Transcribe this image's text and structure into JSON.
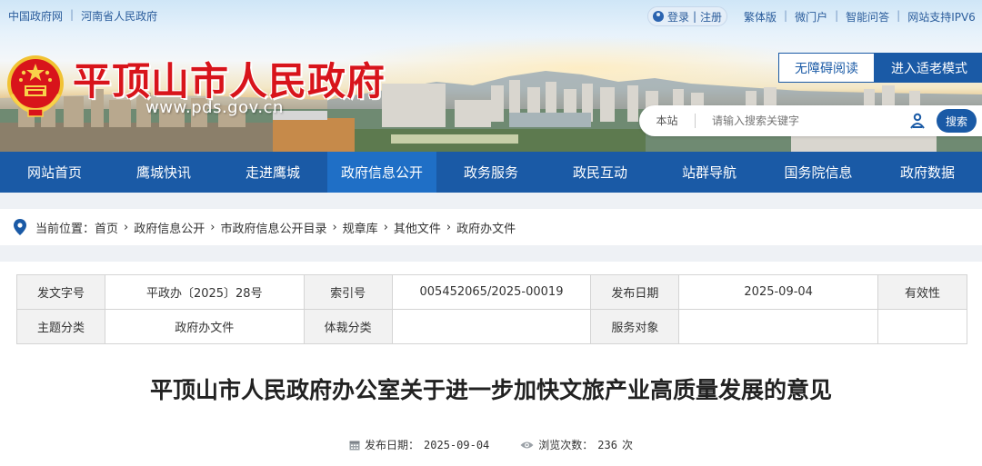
{
  "topbar": {
    "links": [
      "中国政府网",
      "河南省人民政府"
    ],
    "login": "登录",
    "register": "注册",
    "quick_links": [
      "繁体版",
      "微门户",
      "智能问答",
      "网站支持IPV6"
    ]
  },
  "header": {
    "site_title": "平顶山市人民政府",
    "site_url": "www.pds.gov.cn",
    "btn_barrier_free": "无障碍阅读",
    "btn_elder_mode": "进入适老模式",
    "search_scope": "本站",
    "search_placeholder": "请输入搜索关键字",
    "search_button": "搜索"
  },
  "nav": {
    "items": [
      "网站首页",
      "鹰城快讯",
      "走进鹰城",
      "政府信息公开",
      "政务服务",
      "政民互动",
      "站群导航",
      "国务院信息",
      "政府数据"
    ],
    "active": "政府信息公开"
  },
  "breadcrumb": {
    "label": "当前位置：",
    "items": [
      "首页",
      "政府信息公开",
      "市政府信息公开目录",
      "规章库",
      "其他文件",
      "政府办文件"
    ]
  },
  "meta_table": {
    "row1": [
      "发文字号",
      "平政办〔2025〕28号",
      "索引号",
      "005452065/2025-00019",
      "发布日期",
      "2025-09-04",
      "有效性"
    ],
    "row2": [
      "主题分类",
      "政府办文件",
      "体裁分类",
      "",
      "服务对象",
      "",
      ""
    ]
  },
  "document": {
    "title": "平顶山市人民政府办公室关于进一步加快文旅产业高质量发展的意见",
    "publish_label": "发布日期：",
    "publish_date": "2025-09-04",
    "views_label": "浏览次数：",
    "views_count": "236",
    "views_unit": "次"
  },
  "colors": {
    "primary": "#1a5aa6",
    "nav_active": "#1f6fc6",
    "title_red": "#d8141b"
  }
}
